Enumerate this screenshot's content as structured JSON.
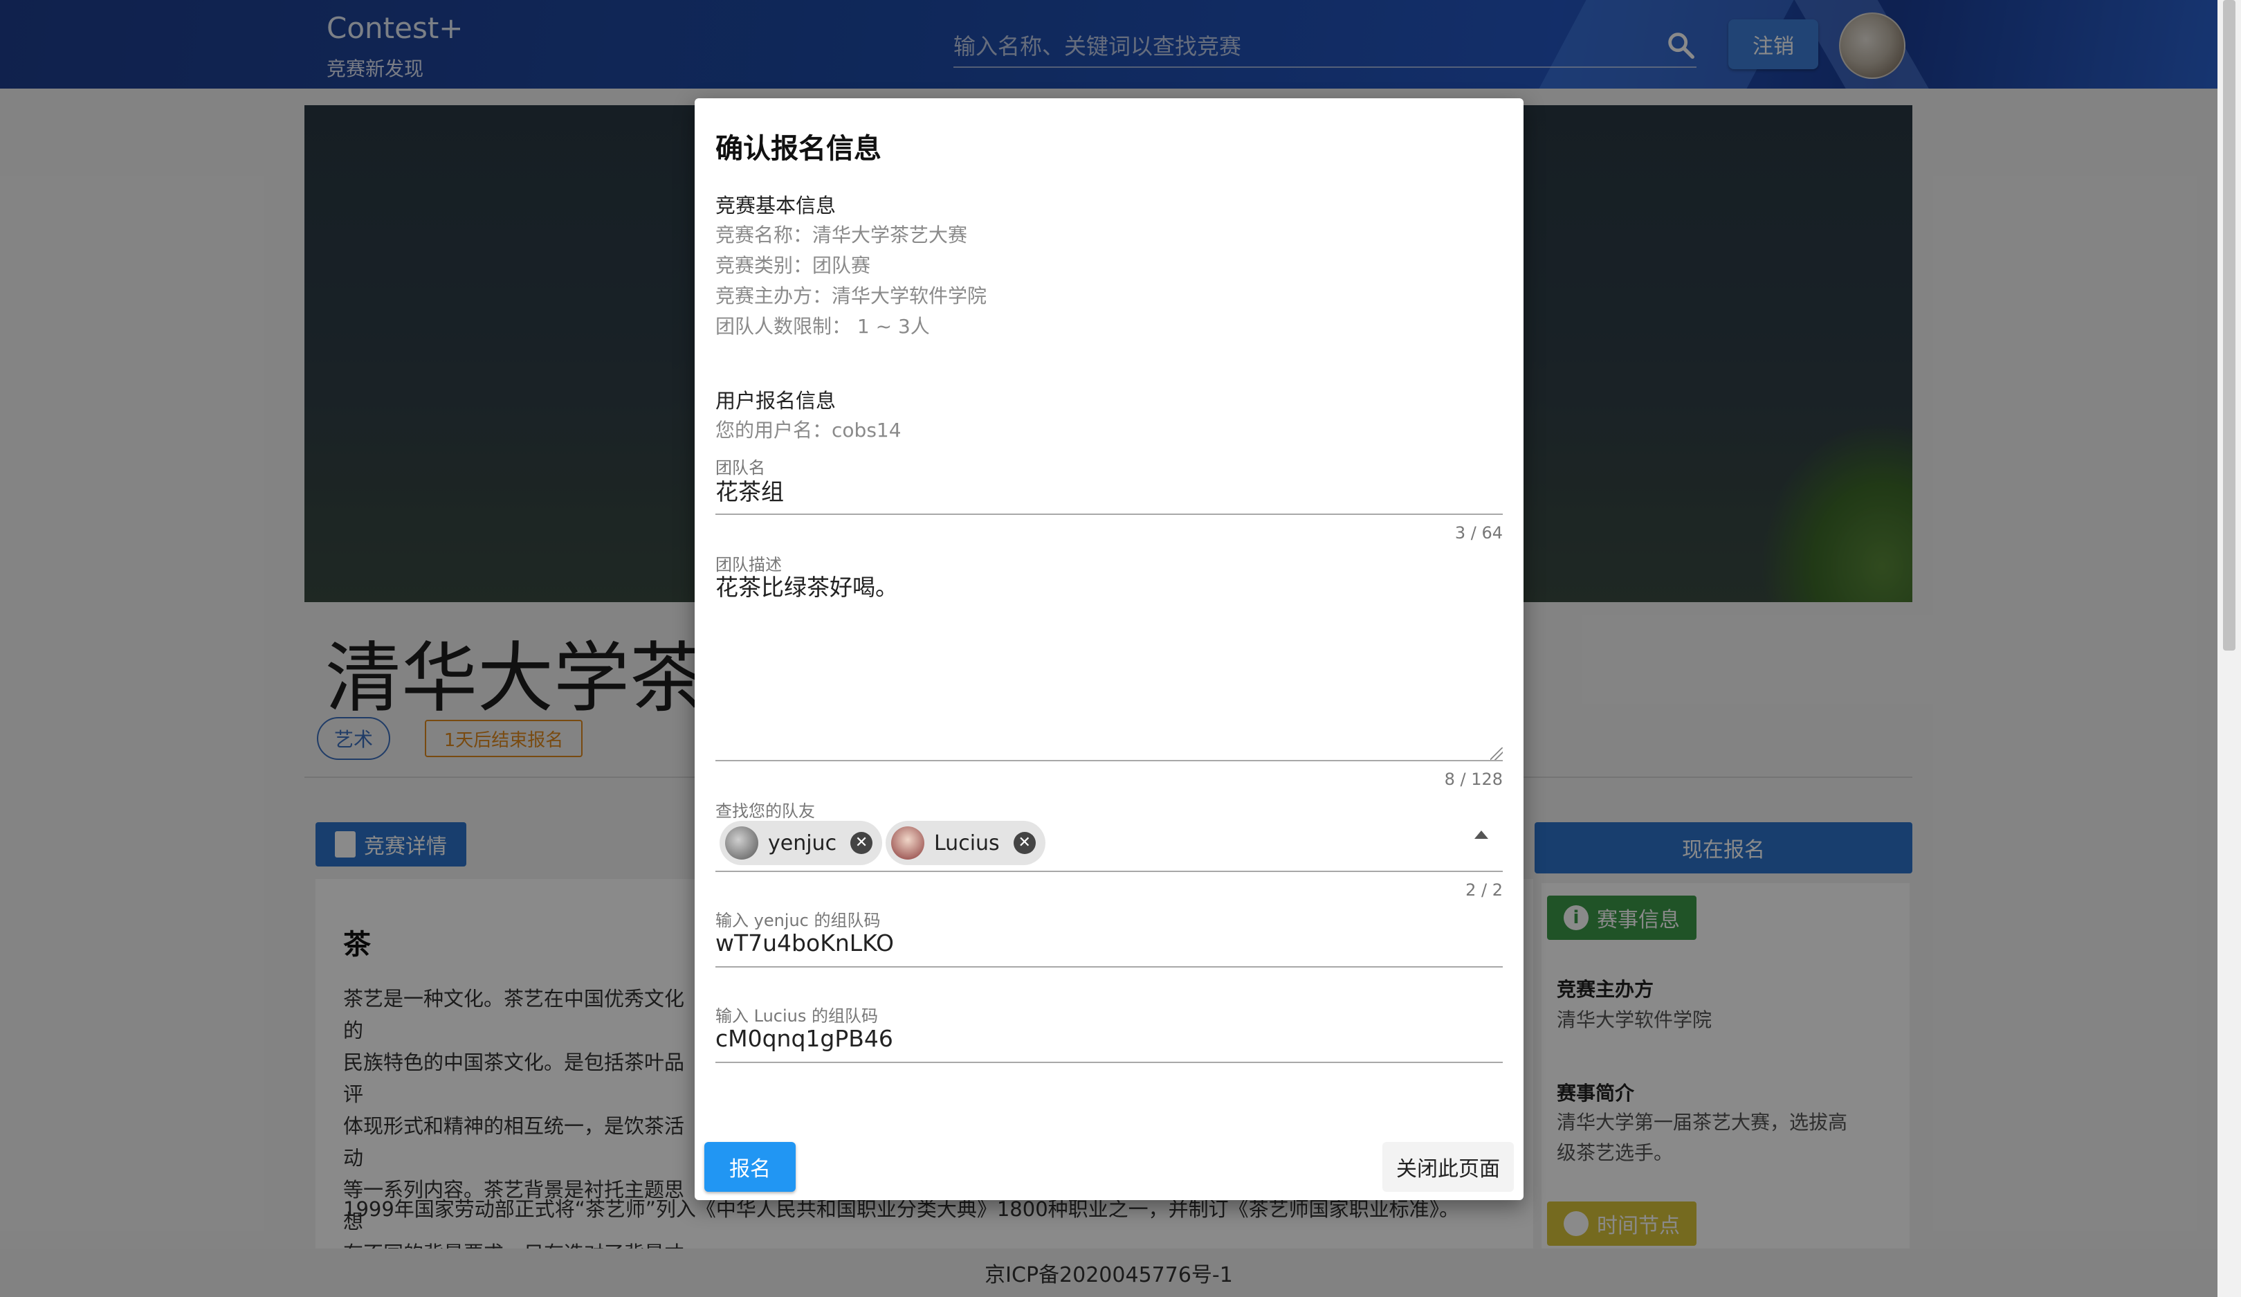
{
  "header": {
    "brand_title": "Contest+",
    "brand_subtitle": "竞赛新发现",
    "search_placeholder": "输入名称、关键词以查找竞赛",
    "logout_label": "注销"
  },
  "page": {
    "title": "清华大学茶艺",
    "tags": [
      "艺术",
      "1天后结束报名"
    ],
    "detail_button": "竞赛详情",
    "content_heading": "茶",
    "content_lines": [
      "茶艺是一种文化。茶艺在中国优秀文化的",
      "民族特色的中国茶文化。是包括茶叶品评",
      "体现形式和精神的相互统一，是饮茶活动",
      "等一系列内容。茶艺背景是衬托主题思想",
      "有不同的背景要求，只有选对了背景才能"
    ],
    "content_paragraph2": "1999年国家劳动部正式将“茶艺师”列入《中华人民共和国职业分类大典》1800种职业之一，并制订《茶艺师国家职业标准》。",
    "signup_button": "现在报名",
    "info_chip": "赛事信息",
    "organizer_heading": "竞赛主办方",
    "organizer_value": "清华大学软件学院",
    "intro_heading": "赛事简介",
    "intro_value": "清华大学第一届茶艺大赛，选拔高级茶艺选手。",
    "time_chip": "时间节点",
    "footer": "京ICP备2020045776号-1"
  },
  "dialog": {
    "title": "确认报名信息",
    "basic_heading": "竞赛基本信息",
    "basic_info": [
      {
        "label": "竞赛名称：",
        "value": "清华大学茶艺大赛"
      },
      {
        "label": "竞赛类别：",
        "value": "团队赛"
      },
      {
        "label": "竞赛主办方：",
        "value": "清华大学软件学院"
      },
      {
        "label": "团队人数限制：",
        "value": " 1 ~ 3人"
      }
    ],
    "user_heading": "用户报名信息",
    "username_label": "您的用户名：",
    "username_value": "cobs14",
    "team_name_label": "团队名",
    "team_name_value": "花茶组",
    "team_name_counter": "3 / 64",
    "team_desc_label": "团队描述",
    "team_desc_value": "花茶比绿茶好喝。",
    "team_desc_counter": "8 / 128",
    "teammate_label": "查找您的队友",
    "teammates": [
      "yenjuc",
      "Lucius"
    ],
    "teammate_counter": "2 / 2",
    "code_fields": [
      {
        "label": "输入 yenjuc 的组队码",
        "value": "wT7u4boKnLKO"
      },
      {
        "label": "输入 Lucius 的组队码",
        "value": "cM0qnq1gPB46"
      }
    ],
    "submit_label": "报名",
    "close_label": "关闭此页面"
  }
}
